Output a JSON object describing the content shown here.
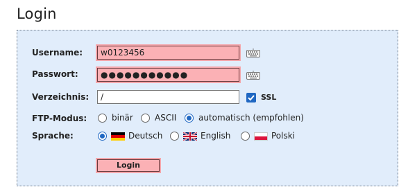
{
  "page": {
    "title": "Login"
  },
  "form": {
    "username": {
      "label": "Username:",
      "value": "w0123456"
    },
    "password": {
      "label": "Passwort:",
      "value": "●●●●●●●●●●●"
    },
    "directory": {
      "label": "Verzeichnis:",
      "value": "/",
      "ssl_label": "SSL",
      "ssl_checked": true
    },
    "ftp_mode": {
      "label": "FTP-Modus:",
      "options": [
        "binär",
        "ASCII",
        "automatisch (empfohlen)"
      ],
      "selected": "automatisch (empfohlen)"
    },
    "language": {
      "label": "Sprache:",
      "options": [
        "Deutsch",
        "English",
        "Polski"
      ],
      "selected": "Deutsch"
    },
    "submit_label": "Login"
  },
  "colors": {
    "panel_bg": "#e1edfb",
    "error_field_bg": "#fbb1b5",
    "accent_blue": "#1f67c2"
  },
  "icons": [
    "keyboard-icon",
    "flag-de-icon",
    "flag-uk-icon",
    "flag-pl-icon"
  ]
}
